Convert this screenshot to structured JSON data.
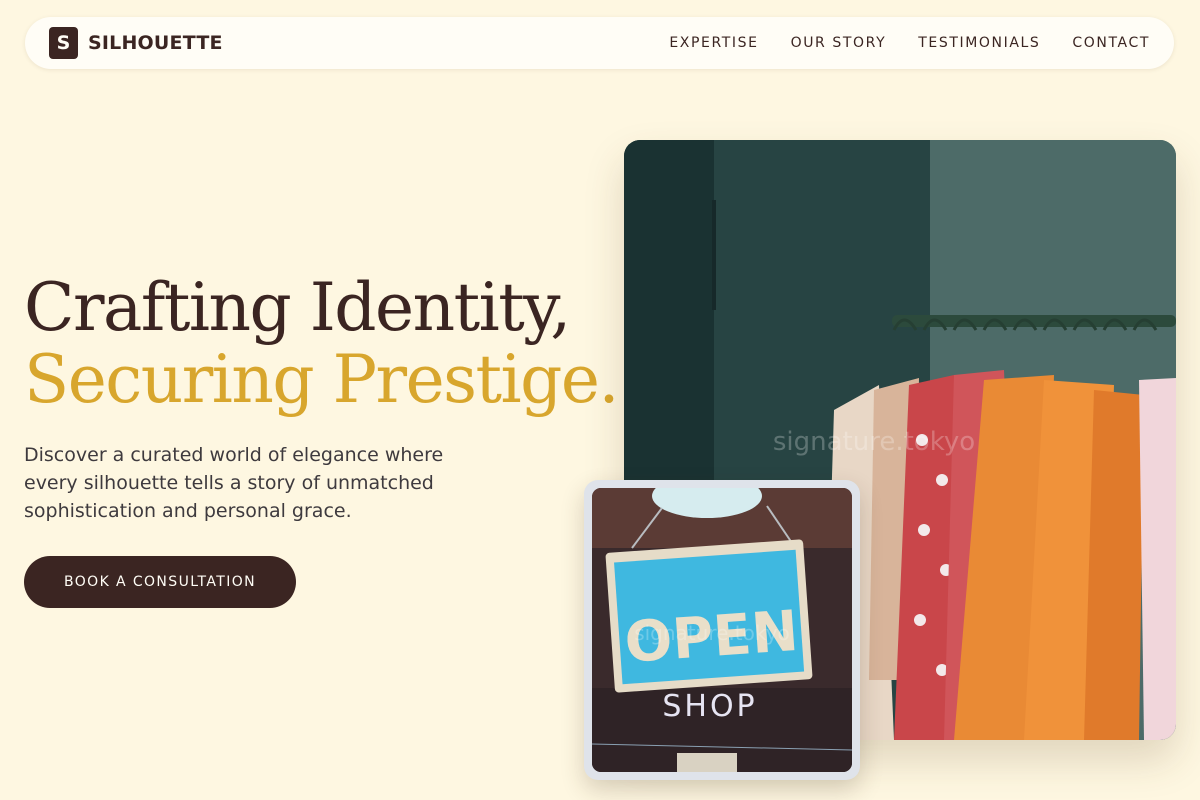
{
  "brand": {
    "mark": "S",
    "name": "SILHOUETTE"
  },
  "nav": {
    "links": [
      "EXPERTISE",
      "OUR STORY",
      "TESTIMONIALS",
      "CONTACT"
    ]
  },
  "hero": {
    "title_line1": "Crafting Identity,",
    "title_line2": "Securing Prestige.",
    "subtitle": "Discover a curated world of elegance where every silhouette tells a story of unmatched sophistication and personal grace.",
    "cta": "BOOK A CONSULTATION"
  },
  "images": {
    "main_watermark": "signature.tokyo",
    "sign_text": "OPEN",
    "sign_shop": "SHOP",
    "small_watermark": "signature.tokyo"
  },
  "colors": {
    "background": "#fef7e1",
    "primary": "#3b2522",
    "accent": "#d8a62d"
  }
}
